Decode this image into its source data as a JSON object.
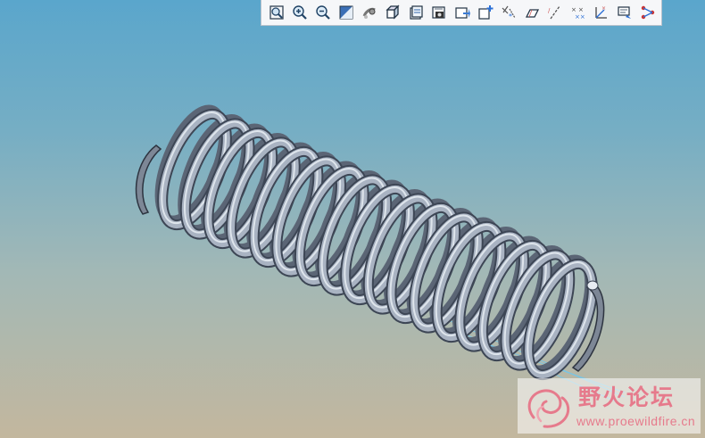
{
  "toolbar": {
    "buttons": [
      {
        "icon": "refit-icon"
      },
      {
        "icon": "zoom-in-icon"
      },
      {
        "icon": "zoom-out-icon"
      },
      {
        "icon": "repaint-icon"
      },
      {
        "icon": "spin-center-icon"
      },
      {
        "icon": "display-style-icon"
      },
      {
        "icon": "saved-orientations-icon"
      },
      {
        "icon": "view-manager-icon"
      },
      {
        "icon": "appearance-icon"
      },
      {
        "icon": "annotation-display-icon"
      },
      {
        "icon": "datum-planes-icon"
      },
      {
        "icon": "datum-planes-alt-icon"
      },
      {
        "icon": "datum-axes-icon"
      },
      {
        "icon": "datum-points-icon"
      },
      {
        "icon": "coordinate-systems-icon"
      },
      {
        "icon": "note-display-icon"
      },
      {
        "icon": "network-icon"
      }
    ]
  },
  "colors": {
    "background_top": "#5aa6cc",
    "background_bottom": "#c3b79e",
    "spring_metal": "#a9b3c2",
    "spring_shadow": "#3d4655",
    "axis_line": "#6fc7ef",
    "watermark": "#e67a8c"
  },
  "watermark": {
    "title": "野火论坛",
    "url": "www.proewildfire.cn"
  }
}
